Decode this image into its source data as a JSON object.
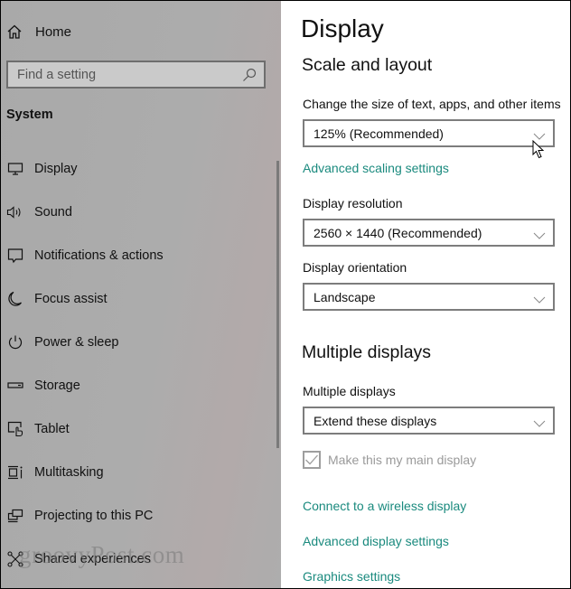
{
  "sidebar": {
    "home_label": "Home",
    "search": {
      "placeholder": "Find a setting",
      "value": ""
    },
    "section_title": "System",
    "items": [
      {
        "label": "Display",
        "icon": "monitor-icon"
      },
      {
        "label": "Sound",
        "icon": "speaker-icon"
      },
      {
        "label": "Notifications & actions",
        "icon": "notification-icon"
      },
      {
        "label": "Focus assist",
        "icon": "moon-icon"
      },
      {
        "label": "Power & sleep",
        "icon": "power-icon"
      },
      {
        "label": "Storage",
        "icon": "storage-icon"
      },
      {
        "label": "Tablet",
        "icon": "tablet-icon"
      },
      {
        "label": "Multitasking",
        "icon": "multitasking-icon"
      },
      {
        "label": "Projecting to this PC",
        "icon": "projecting-icon"
      },
      {
        "label": "Shared experiences",
        "icon": "shared-experiences-icon"
      }
    ]
  },
  "watermark": "groovyPost.com",
  "main": {
    "title": "Display",
    "scale_section": {
      "heading": "Scale and layout",
      "scale_label": "Change the size of text, apps, and other items",
      "scale_value": "125% (Recommended)",
      "advanced_scaling_link": "Advanced scaling settings",
      "resolution_label": "Display resolution",
      "resolution_value": "2560 × 1440 (Recommended)",
      "orientation_label": "Display orientation",
      "orientation_value": "Landscape"
    },
    "multi_section": {
      "heading": "Multiple displays",
      "multi_label": "Multiple displays",
      "multi_value": "Extend these displays",
      "main_display_checkbox": {
        "label": "Make this my main display",
        "checked": true,
        "disabled": true
      },
      "links": [
        "Connect to a wireless display",
        "Advanced display settings",
        "Graphics settings"
      ]
    }
  },
  "colors": {
    "link": "#1a8a7e",
    "sidebar_bg": "#acacac",
    "dropdown_border": "#7d7d7d"
  }
}
